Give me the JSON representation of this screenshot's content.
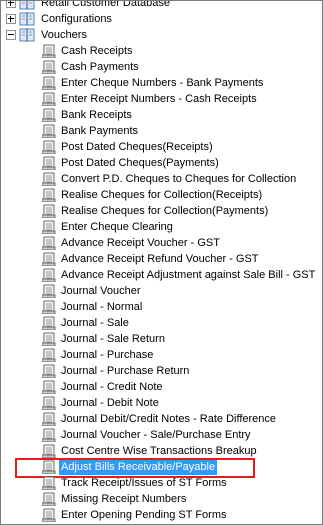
{
  "tree": {
    "top_items": [
      {
        "label": "Retail Customer Database",
        "expanded": false
      },
      {
        "label": "Configurations",
        "expanded": false
      },
      {
        "label": "Vouchers",
        "expanded": true
      }
    ],
    "voucher_items": [
      "Cash Receipts",
      "Cash Payments",
      "Enter Cheque Numbers - Bank Payments",
      "Enter Receipt Numbers - Cash Receipts",
      "Bank Receipts",
      "Bank Payments",
      "Post Dated Cheques(Receipts)",
      "Post Dated Cheques(Payments)",
      "Convert P.D. Cheques to Cheques for Collection",
      "Realise Cheques for Collection(Receipts)",
      "Realise Cheques for Collection(Payments)",
      "Enter Cheque Clearing",
      "Advance Receipt Voucher - GST",
      "Advance Receipt Refund Voucher - GST",
      "Advance Receipt Adjustment against Sale Bill - GST",
      "Journal Voucher",
      "Journal - Normal",
      "Journal - Sale",
      "Journal - Sale Return",
      "Journal - Purchase",
      "Journal - Purchase Return",
      "Journal - Credit Note",
      "Journal - Debit Note",
      "Journal Debit/Credit Notes - Rate Difference",
      "Journal Voucher - Sale/Purchase Entry",
      "Cost Centre Wise Transactions Breakup",
      "Adjust Bills Receivable/Payable",
      "Track Receipt/Issues of ST Forms",
      "Missing Receipt Numbers",
      "Enter Opening  Pending ST Forms"
    ],
    "selected_item": "Adjust Bills Receivable/Payable",
    "icons": {
      "folder": "book-icon",
      "leaf": "document-icon"
    },
    "colors": {
      "selection": "#3399ff",
      "highlight_border": "#e01e1e"
    }
  }
}
